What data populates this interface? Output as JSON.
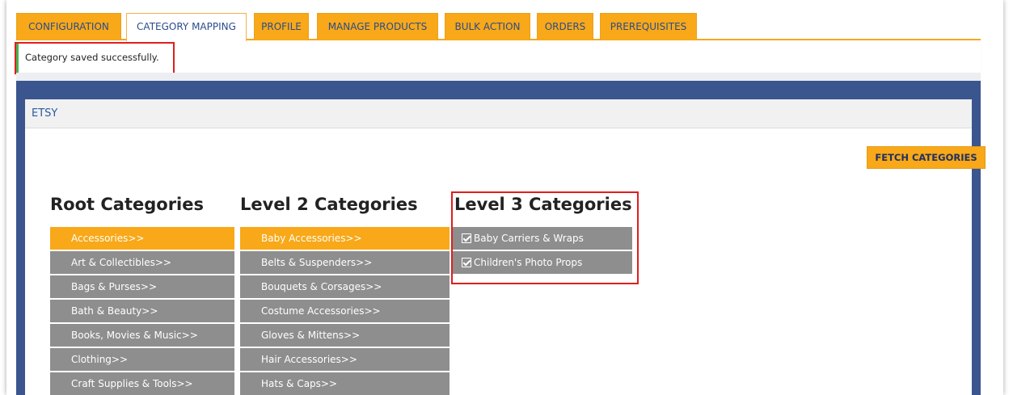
{
  "tabs": [
    {
      "label": "CONFIGURATION"
    },
    {
      "label": "CATEGORY MAPPING"
    },
    {
      "label": "PROFILE"
    },
    {
      "label": "MANAGE PRODUCTS"
    },
    {
      "label": "BULK ACTION"
    },
    {
      "label": "ORDERS"
    },
    {
      "label": "PREREQUISITES"
    }
  ],
  "active_tab": "CATEGORY MAPPING",
  "notice": {
    "text": "Category saved successfully."
  },
  "panel": {
    "title": "ETSY",
    "fetch_button": "FETCH CATEGORIES"
  },
  "columns": {
    "root": {
      "title": "Root Categories",
      "items": [
        {
          "label": "Accessories>>"
        },
        {
          "label": "Art & Collectibles>>"
        },
        {
          "label": "Bags & Purses>>"
        },
        {
          "label": "Bath & Beauty>>"
        },
        {
          "label": "Books, Movies & Music>>"
        },
        {
          "label": "Clothing>>"
        },
        {
          "label": "Craft Supplies & Tools>>"
        }
      ],
      "selected": "Accessories>>"
    },
    "level2": {
      "title": "Level 2 Categories",
      "items": [
        {
          "label": "Baby Accessories>>"
        },
        {
          "label": "Belts & Suspenders>>"
        },
        {
          "label": "Bouquets & Corsages>>"
        },
        {
          "label": "Costume Accessories>>"
        },
        {
          "label": "Gloves & Mittens>>"
        },
        {
          "label": "Hair Accessories>>"
        },
        {
          "label": "Hats & Caps>>"
        }
      ],
      "selected": "Baby Accessories>>"
    },
    "level3": {
      "title": "Level 3 Categories",
      "items": [
        {
          "label": "Baby Carriers & Wraps",
          "checked": true
        },
        {
          "label": "Children's Photo Props",
          "checked": true
        }
      ]
    }
  },
  "colors": {
    "accent": "#f8a818",
    "panel_bg": "#3b568f",
    "item_bg": "#8e8e8e",
    "highlight": "#e01e1e",
    "success": "#46b450"
  }
}
